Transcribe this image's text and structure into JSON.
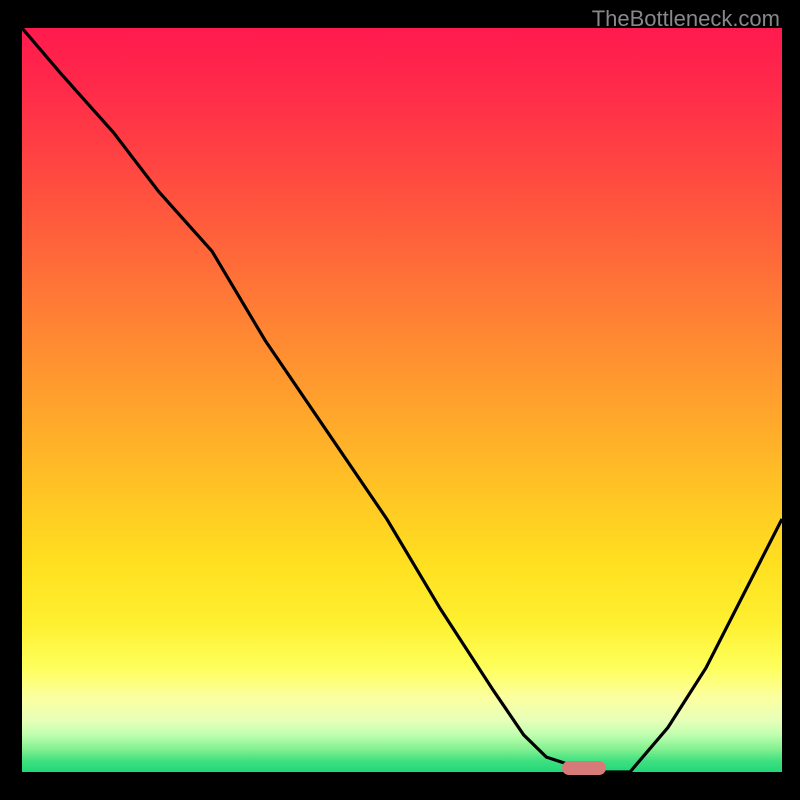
{
  "watermark": "TheBottleneck.com",
  "chart_data": {
    "type": "line",
    "title": "",
    "xlabel": "",
    "ylabel": "",
    "xlim": [
      0,
      100
    ],
    "ylim": [
      0,
      100
    ],
    "x": [
      0,
      5,
      12,
      18,
      25,
      32,
      40,
      48,
      55,
      62,
      66,
      69,
      72,
      76,
      80,
      85,
      90,
      95,
      100
    ],
    "values": [
      100,
      94,
      86,
      78,
      70,
      58,
      46,
      34,
      22,
      11,
      5,
      2,
      1,
      0,
      0,
      6,
      14,
      24,
      34
    ],
    "grid": false,
    "background_gradient": {
      "orientation": "vertical",
      "stops": [
        {
          "pos": 0.0,
          "color": "#ff1a4e"
        },
        {
          "pos": 0.5,
          "color": "#ffac2a"
        },
        {
          "pos": 0.85,
          "color": "#feff5c"
        },
        {
          "pos": 1.0,
          "color": "#20d878"
        }
      ]
    },
    "marker": {
      "x": 74,
      "y": 0,
      "color": "#d97a7a",
      "shape": "pill"
    }
  }
}
